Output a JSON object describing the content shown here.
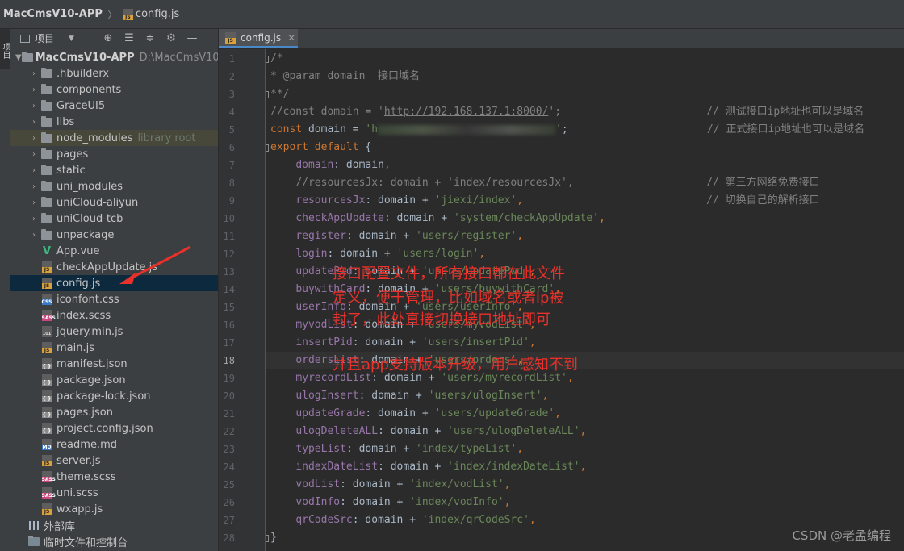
{
  "titlebar": {
    "project": "MacCmsV10-APP",
    "file": "config.js"
  },
  "left_strip": {
    "label": "项目"
  },
  "project_panel": {
    "view_label": "项目",
    "root": {
      "name": "MacCmsV10-APP",
      "path": "D:\\MacCmsV10-A"
    },
    "items": [
      {
        "name": ".hbuilderx",
        "kind": "folder"
      },
      {
        "name": "components",
        "kind": "folder"
      },
      {
        "name": "GraceUI5",
        "kind": "folder"
      },
      {
        "name": "libs",
        "kind": "folder"
      },
      {
        "name": "node_modules",
        "kind": "folder",
        "note": "library root"
      },
      {
        "name": "pages",
        "kind": "folder"
      },
      {
        "name": "static",
        "kind": "folder"
      },
      {
        "name": "uni_modules",
        "kind": "folder"
      },
      {
        "name": "uniCloud-aliyun",
        "kind": "folder"
      },
      {
        "name": "uniCloud-tcb",
        "kind": "folder"
      },
      {
        "name": "unpackage",
        "kind": "folder"
      },
      {
        "name": "App.vue",
        "kind": "vue"
      },
      {
        "name": "checkAppUpdate.js",
        "kind": "js"
      },
      {
        "name": "config.js",
        "kind": "js",
        "selected": true
      },
      {
        "name": "iconfont.css",
        "kind": "css"
      },
      {
        "name": "index.scss",
        "kind": "sass"
      },
      {
        "name": "jquery.min.js",
        "kind": "bin"
      },
      {
        "name": "main.js",
        "kind": "js"
      },
      {
        "name": "manifest.json",
        "kind": "json"
      },
      {
        "name": "package.json",
        "kind": "json"
      },
      {
        "name": "package-lock.json",
        "kind": "json"
      },
      {
        "name": "pages.json",
        "kind": "json"
      },
      {
        "name": "project.config.json",
        "kind": "json"
      },
      {
        "name": "readme.md",
        "kind": "md"
      },
      {
        "name": "server.js",
        "kind": "js"
      },
      {
        "name": "theme.scss",
        "kind": "sass"
      },
      {
        "name": "uni.scss",
        "kind": "sass"
      },
      {
        "name": "wxapp.js",
        "kind": "js"
      }
    ],
    "external_libraries": "外部库",
    "scratches": "临时文件和控制台"
  },
  "editor": {
    "tab_label": "config.js",
    "current_line": 18,
    "lines": [
      [
        [
          "cmt",
          "/*"
        ]
      ],
      [
        [
          "cmt",
          "* @param domain  接口域名"
        ]
      ],
      [
        [
          "cmt",
          "**/"
        ]
      ],
      [
        [
          "cmt",
          "//const domain = '"
        ],
        [
          "cmt url",
          "http://192.168.137.1:8000/"
        ],
        [
          "cmt",
          "';"
        ],
        [
          "pad",
          48
        ],
        [
          "cmt",
          "// 测试接口ip地址也可以是域名"
        ]
      ],
      [
        [
          "kw",
          "const"
        ],
        [
          "txt",
          " domain = "
        ],
        [
          "str",
          "'h"
        ],
        [
          "blur",
          ""
        ],
        [
          "str",
          "'"
        ],
        [
          "txt",
          ";"
        ],
        [
          "pad",
          48
        ],
        [
          "cmt",
          "// 正式接口ip地址也可以是域名"
        ]
      ],
      [
        [
          "kw",
          "export default"
        ],
        [
          "txt",
          " {"
        ]
      ],
      [
        [
          "txt",
          "    "
        ],
        [
          "prop",
          "domain"
        ],
        [
          "txt",
          ": domain"
        ],
        [
          "kw",
          ","
        ]
      ],
      [
        [
          "txt",
          "    "
        ],
        [
          "cmt",
          "//resourcesJx: domain + 'index/resourcesJx',"
        ],
        [
          "pad",
          72
        ],
        [
          "cmt",
          "// 第三方网络免费接口"
        ]
      ],
      [
        [
          "txt",
          "    "
        ],
        [
          "prop",
          "resourcesJx"
        ],
        [
          "txt",
          ": domain + "
        ],
        [
          "str",
          "'jiexi/index'"
        ],
        [
          "kw",
          ","
        ],
        [
          "pad",
          72
        ],
        [
          "cmt",
          "// 切换自己的解析接口"
        ]
      ],
      [
        [
          "txt",
          "    "
        ],
        [
          "prop",
          "checkAppUpdate"
        ],
        [
          "txt",
          ": domain + "
        ],
        [
          "str",
          "'system/checkAppUpdate'"
        ],
        [
          "kw",
          ","
        ]
      ],
      [
        [
          "txt",
          "    "
        ],
        [
          "prop",
          "register"
        ],
        [
          "txt",
          ": domain + "
        ],
        [
          "str",
          "'users/register'"
        ],
        [
          "kw",
          ","
        ]
      ],
      [
        [
          "txt",
          "    "
        ],
        [
          "prop",
          "login"
        ],
        [
          "txt",
          ": domain + "
        ],
        [
          "str",
          "'users/login'"
        ],
        [
          "kw",
          ","
        ]
      ],
      [
        [
          "txt",
          "    "
        ],
        [
          "prop",
          "updatePwd"
        ],
        [
          "txt",
          ": domain + "
        ],
        [
          "str",
          "'users/updatePwd'"
        ],
        [
          "kw",
          ","
        ]
      ],
      [
        [
          "txt",
          "    "
        ],
        [
          "prop",
          "buywithCard"
        ],
        [
          "txt",
          ": domain + "
        ],
        [
          "str",
          "'users/buywithCard'"
        ],
        [
          "kw",
          ","
        ]
      ],
      [
        [
          "txt",
          "    "
        ],
        [
          "prop",
          "userInfo"
        ],
        [
          "txt",
          ": domain + "
        ],
        [
          "str",
          "'users/userInfo'"
        ],
        [
          "kw",
          ","
        ]
      ],
      [
        [
          "txt",
          "    "
        ],
        [
          "prop",
          "myvodList"
        ],
        [
          "txt",
          ": domain + "
        ],
        [
          "str",
          "'users/myvodList'"
        ],
        [
          "kw",
          ","
        ]
      ],
      [
        [
          "txt",
          "    "
        ],
        [
          "prop",
          "insertPid"
        ],
        [
          "txt",
          ": domain + "
        ],
        [
          "str",
          "'users/insertPid'"
        ],
        [
          "kw",
          ","
        ]
      ],
      [
        [
          "txt",
          "    "
        ],
        [
          "prop",
          "ordersList"
        ],
        [
          "txt",
          ": domain + "
        ],
        [
          "str",
          "'users/orders'"
        ],
        [
          "kw",
          ","
        ]
      ],
      [
        [
          "txt",
          "    "
        ],
        [
          "prop",
          "myrecordList"
        ],
        [
          "txt",
          ": domain + "
        ],
        [
          "str",
          "'users/myrecordList'"
        ],
        [
          "kw",
          ","
        ]
      ],
      [
        [
          "txt",
          "    "
        ],
        [
          "prop",
          "ulogInsert"
        ],
        [
          "txt",
          ": domain + "
        ],
        [
          "str",
          "'users/ulogInsert'"
        ],
        [
          "kw",
          ","
        ]
      ],
      [
        [
          "txt",
          "    "
        ],
        [
          "prop",
          "updateGrade"
        ],
        [
          "txt",
          ": domain + "
        ],
        [
          "str",
          "'users/updateGrade'"
        ],
        [
          "kw",
          ","
        ]
      ],
      [
        [
          "txt",
          "    "
        ],
        [
          "prop",
          "ulogDeleteALL"
        ],
        [
          "txt",
          ": domain + "
        ],
        [
          "str",
          "'users/ulogDeleteALL'"
        ],
        [
          "kw",
          ","
        ]
      ],
      [
        [
          "txt",
          "    "
        ],
        [
          "prop",
          "typeList"
        ],
        [
          "txt",
          ": domain + "
        ],
        [
          "str",
          "'index/typeList'"
        ],
        [
          "kw",
          ","
        ]
      ],
      [
        [
          "txt",
          "    "
        ],
        [
          "prop",
          "indexDateList"
        ],
        [
          "txt",
          ": domain + "
        ],
        [
          "str",
          "'index/indexDateList'"
        ],
        [
          "kw",
          ","
        ]
      ],
      [
        [
          "txt",
          "    "
        ],
        [
          "prop",
          "vodList"
        ],
        [
          "txt",
          ": domain + "
        ],
        [
          "str",
          "'index/vodList'"
        ],
        [
          "kw",
          ","
        ]
      ],
      [
        [
          "txt",
          "    "
        ],
        [
          "prop",
          "vodInfo"
        ],
        [
          "txt",
          ": domain + "
        ],
        [
          "str",
          "'index/vodInfo'"
        ],
        [
          "kw",
          ","
        ]
      ],
      [
        [
          "txt",
          "    "
        ],
        [
          "prop",
          "qrCodeSrc"
        ],
        [
          "txt",
          ": domain + "
        ],
        [
          "str",
          "'index/qrCodeSrc'"
        ],
        [
          "kw",
          ","
        ]
      ],
      [
        [
          "txt",
          "}"
        ]
      ]
    ]
  },
  "annotation": {
    "lines": [
      "接口配置文件，所有接口都在此文件",
      "定义，便于管理，比如域名或者ip被",
      "封了，此处直接切换接口地址即可",
      "并且app支持版本升级，用户感知不到"
    ],
    "color": "#e8312a"
  },
  "watermark": "CSDN @老孟编程"
}
